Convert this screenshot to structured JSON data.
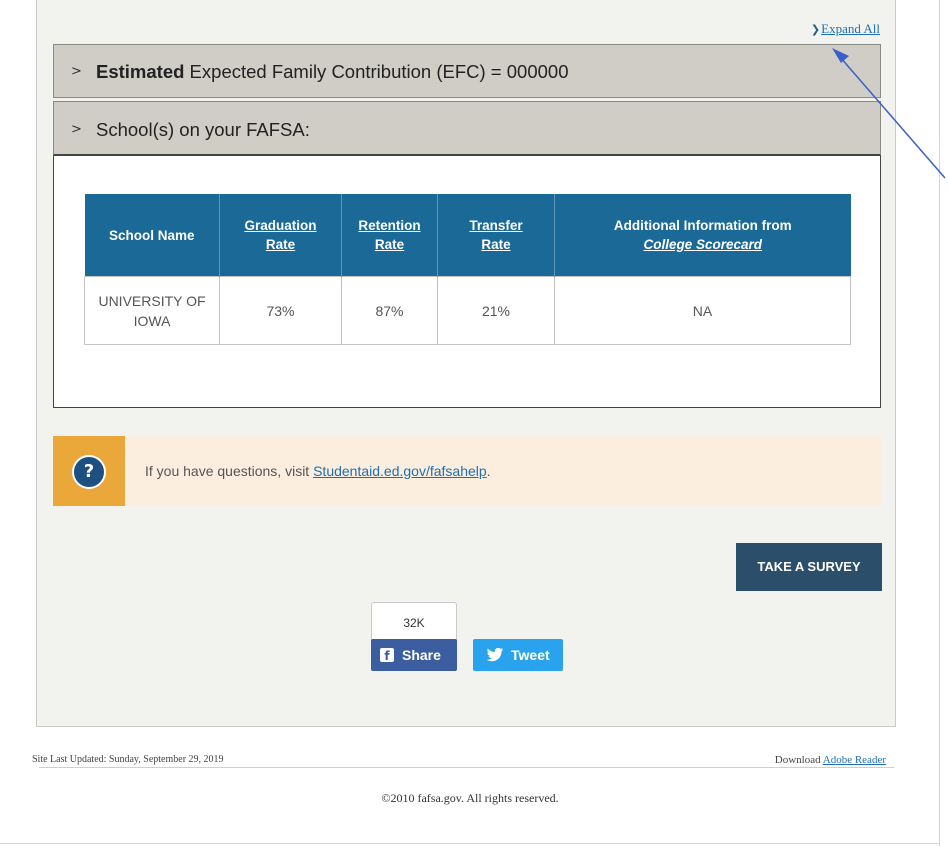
{
  "header": {
    "expand_all_label": "Expand All"
  },
  "accordions": [
    {
      "bold_text": "Estimated",
      "text": " Expected Family Contribution (EFC) = 000000"
    },
    {
      "text": "School(s) on your FAFSA:"
    }
  ],
  "schools_table": {
    "headers": {
      "school_name": "School Name",
      "grad_line1": "Graduation",
      "grad_line2": "Rate",
      "ret_line1": "Retention",
      "ret_line2": "Rate",
      "trans_line1": "Transfer",
      "trans_line2": "Rate",
      "addl_line1": "Additional Information from",
      "addl_line2": "College Scorecard"
    },
    "rows": [
      {
        "school_line1": "UNIVERSITY OF",
        "school_line2": "IOWA",
        "graduation_rate": "73%",
        "retention_rate": "87%",
        "transfer_rate": "21%",
        "additional_info": "NA"
      }
    ]
  },
  "help": {
    "icon_glyph": "?",
    "message_prefix": "If you have questions, visit ",
    "link_text": "Studentaid.ed.gov/fafsahelp",
    "message_suffix": "."
  },
  "survey_button_label": "TAKE A SURVEY",
  "social": {
    "share_count": "32K",
    "share_label": "Share",
    "tweet_label": "Tweet",
    "icons": [
      "facebook-icon",
      "twitter-icon"
    ]
  },
  "footer": {
    "last_updated": "Site Last Updated: Sunday, September 29, 2019",
    "download_prefix": "Download ",
    "download_link": "Adobe Reader",
    "copyright": "©2010 fafsa.gov. All rights reserved."
  },
  "colors": {
    "table_header_bg": "#1a6996",
    "help_icon_bg": "#eaa83a",
    "help_bg": "#fbeede",
    "survey_bg": "#2b4f6b",
    "facebook_blue": "#3c5da0",
    "twitter_blue": "#2aa3ef",
    "annotation_arrow": "#3a5fc8"
  }
}
